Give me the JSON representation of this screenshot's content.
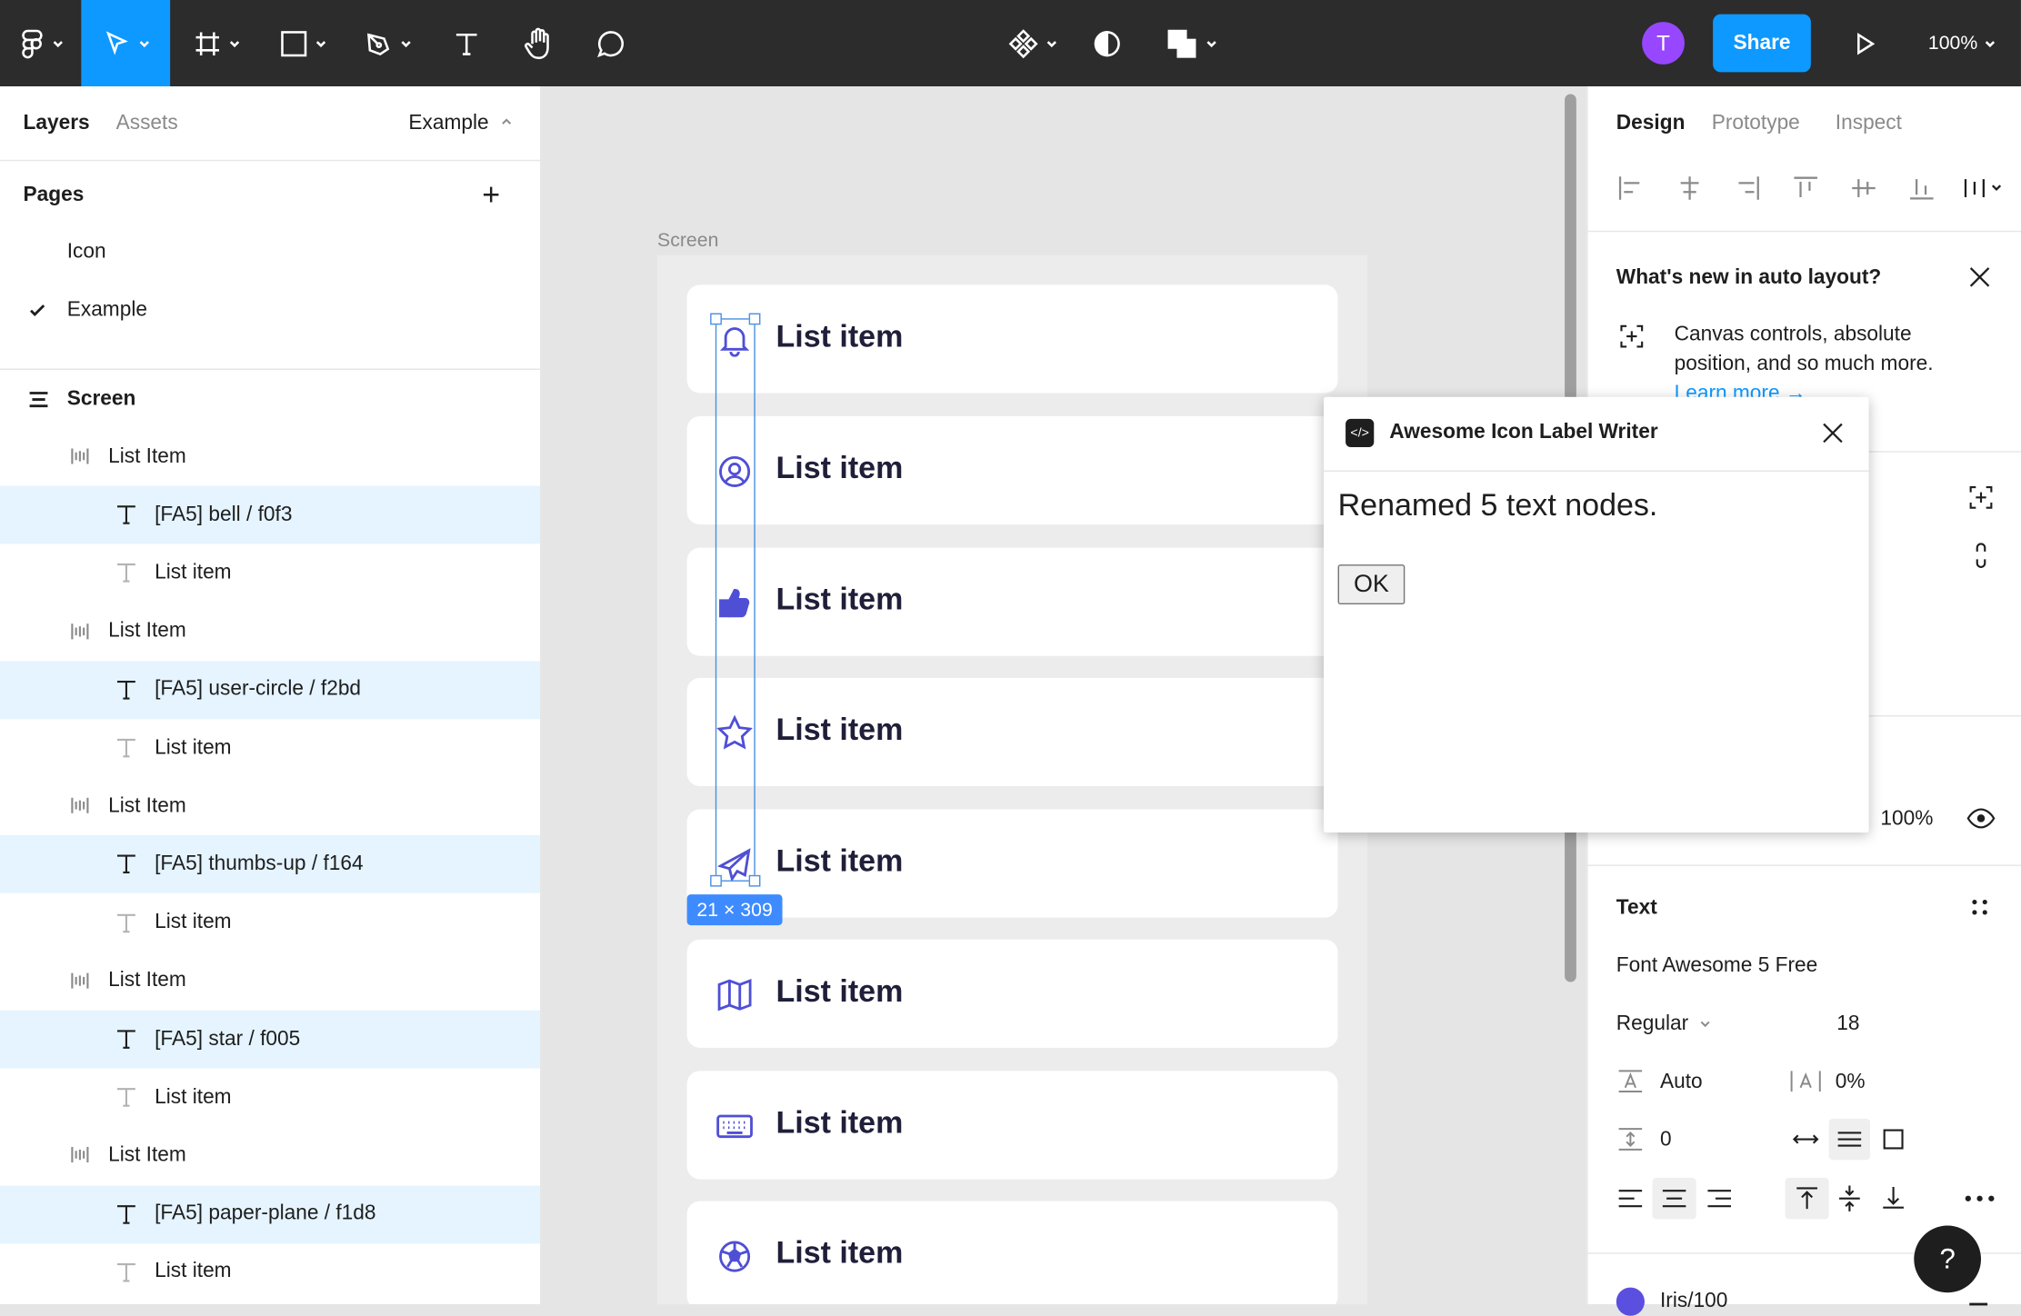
{
  "toolbar": {
    "avatar_letter": "T",
    "share_label": "Share",
    "zoom_label": "100%"
  },
  "left_panel": {
    "tabs": [
      "Layers",
      "Assets"
    ],
    "page_selector": "Example",
    "pages_title": "Pages",
    "pages": [
      {
        "label": "Icon",
        "checked": false
      },
      {
        "label": "Example",
        "checked": true
      }
    ],
    "root_layer": "Screen",
    "layers": [
      {
        "label": "List Item",
        "type": "autolayout"
      },
      {
        "label": "[FA5] bell / f0f3",
        "type": "text",
        "selected": true
      },
      {
        "label": "List item",
        "type": "text"
      },
      {
        "label": "List Item",
        "type": "autolayout"
      },
      {
        "label": "[FA5] user-circle / f2bd",
        "type": "text",
        "selected": true
      },
      {
        "label": "List item",
        "type": "text"
      },
      {
        "label": "List Item",
        "type": "autolayout"
      },
      {
        "label": "[FA5] thumbs-up / f164",
        "type": "text",
        "selected": true
      },
      {
        "label": "List item",
        "type": "text"
      },
      {
        "label": "List Item",
        "type": "autolayout"
      },
      {
        "label": "[FA5] star / f005",
        "type": "text",
        "selected": true
      },
      {
        "label": "List item",
        "type": "text"
      },
      {
        "label": "List Item",
        "type": "autolayout"
      },
      {
        "label": "[FA5] paper-plane / f1d8",
        "type": "text",
        "selected": true
      },
      {
        "label": "List item",
        "type": "text"
      }
    ]
  },
  "canvas": {
    "frame_label": "Screen",
    "selection_size": "21 × 309",
    "cards": [
      {
        "label": "List item",
        "icon": "bell-icon"
      },
      {
        "label": "List item",
        "icon": "user-circle-icon"
      },
      {
        "label": "List item",
        "icon": "thumbs-up-icon"
      },
      {
        "label": "List item",
        "icon": "star-icon"
      },
      {
        "label": "List item",
        "icon": "paper-plane-icon"
      },
      {
        "label": "List item",
        "icon": "map-icon"
      },
      {
        "label": "List item",
        "icon": "keyboard-icon"
      },
      {
        "label": "List item",
        "icon": "futbol-icon"
      }
    ]
  },
  "modal": {
    "title": "Awesome Icon Label Writer",
    "message": "Renamed 5 text nodes.",
    "ok_label": "OK"
  },
  "right_panel": {
    "tabs": [
      "Design",
      "Prototype",
      "Inspect"
    ],
    "whats_new_title": "What's new in auto layout?",
    "whats_new_text_1": "Canvas controls, absolute",
    "whats_new_text_2": "position, and so much more.",
    "learn_more": "Learn more →",
    "opacity": "100%",
    "text_section_title": "Text",
    "font_family": "Font Awesome 5 Free",
    "font_weight": "Regular",
    "font_size": "18",
    "line_height": "Auto",
    "letter_spacing": "0%",
    "paragraph_spacing": "0",
    "fill_name": "Iris/100",
    "fill_color": "#5b4fe0"
  }
}
